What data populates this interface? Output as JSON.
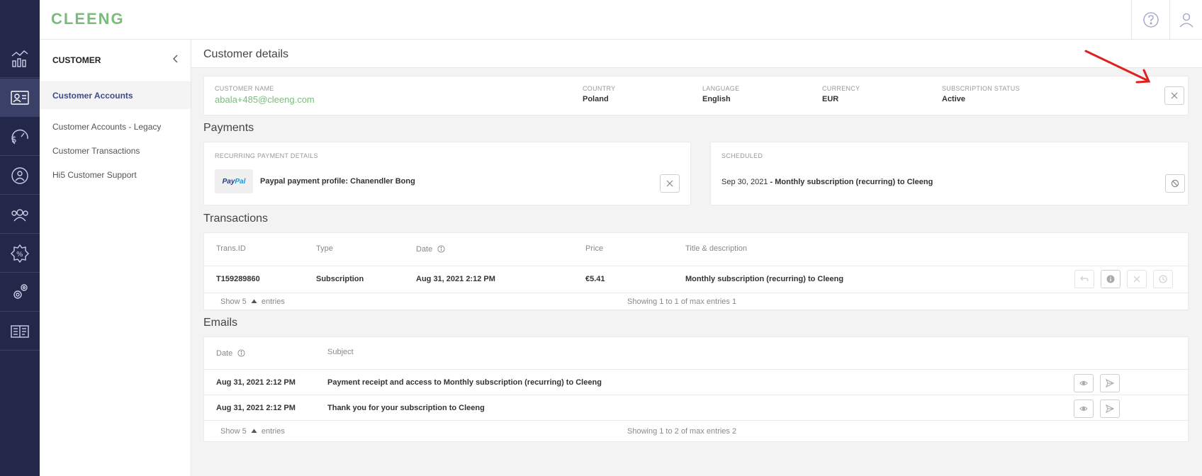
{
  "app": {
    "logo": "CLEENG"
  },
  "rail": {
    "items": [
      {
        "icon": "analytics-icon"
      },
      {
        "icon": "customer-card-icon",
        "active": true
      },
      {
        "icon": "revenue-icon"
      },
      {
        "icon": "retention-icon"
      },
      {
        "icon": "users-icon"
      },
      {
        "icon": "discount-icon"
      },
      {
        "icon": "settings-icon"
      },
      {
        "icon": "reports-icon"
      }
    ]
  },
  "subnav": {
    "heading": "CUSTOMER",
    "items": [
      {
        "label": "Customer Accounts",
        "active": true
      },
      {
        "label": "Customer Accounts - Legacy"
      },
      {
        "label": "Customer Transactions"
      },
      {
        "label": "Hi5 Customer Support"
      }
    ]
  },
  "page": {
    "title": "Customer details"
  },
  "customer": {
    "name_label": "CUSTOMER NAME",
    "name": "abala+485@cleeng.com",
    "country_label": "COUNTRY",
    "country": "Poland",
    "language_label": "LANGUAGE",
    "language": "English",
    "currency_label": "CURRENCY",
    "currency": "EUR",
    "status_label": "SUBSCRIPTION STATUS",
    "status": "Active"
  },
  "payments": {
    "title": "Payments",
    "recurring_label": "RECURRING PAYMENT DETAILS",
    "paypal_a": "Pay",
    "paypal_b": "Pal",
    "profile": "Paypal payment profile: Chanendler Bong",
    "scheduled_label": "SCHEDULED",
    "scheduled_date": "Sep 30, 2021",
    "scheduled_desc": " - Monthly subscription (recurring) to Cleeng"
  },
  "transactions": {
    "title": "Transactions",
    "headers": {
      "id": "Trans.ID",
      "type": "Type",
      "date": "Date",
      "price": "Price",
      "title": "Title & description"
    },
    "rows": [
      {
        "id": "T159289860",
        "type": "Subscription",
        "date": "Aug 31, 2021 2:12 PM",
        "price": "€5.41",
        "title": "Monthly subscription (recurring) to Cleeng"
      }
    ],
    "show_prefix": "Show 5",
    "show_suffix": "entries",
    "showing": "Showing 1 to 1 of max entries 1"
  },
  "emails": {
    "title": "Emails",
    "headers": {
      "date": "Date",
      "subject": "Subject"
    },
    "rows": [
      {
        "date": "Aug 31, 2021 2:12 PM",
        "subject": "Payment receipt and access to Monthly subscription (recurring) to Cleeng"
      },
      {
        "date": "Aug 31, 2021 2:12 PM",
        "subject": "Thank you for your subscription to Cleeng"
      }
    ],
    "show_prefix": "Show 5",
    "show_suffix": "entries",
    "showing": "Showing 1 to 2 of max entries 2"
  },
  "colors": {
    "rail": "#23284a",
    "accent_green": "#7dbb7d",
    "nav_active": "#3f4a8a",
    "annotation_arrow": "#e02020"
  }
}
